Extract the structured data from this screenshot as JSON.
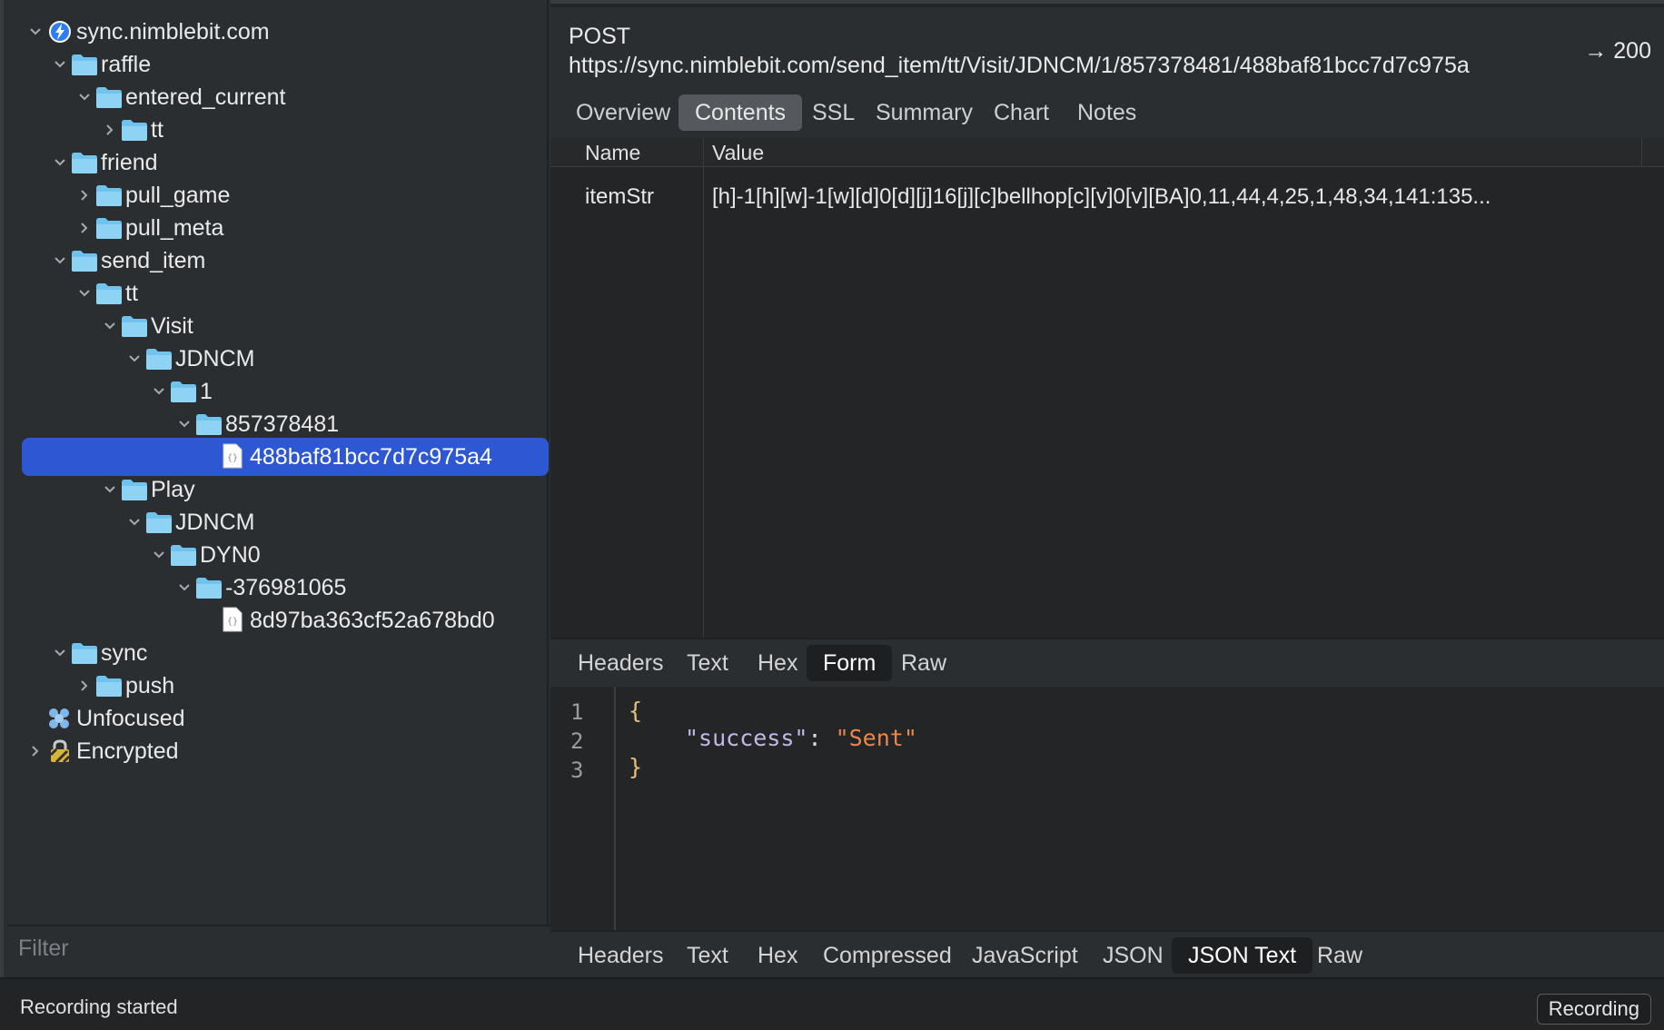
{
  "sidebar": {
    "tree": [
      {
        "label": "sync.nimblebit.com",
        "icon": "lightning-globe-icon"
      },
      {
        "label": "raffle",
        "icon": "folder-icon"
      },
      {
        "label": "entered_current",
        "icon": "folder-icon"
      },
      {
        "label": "tt",
        "icon": "folder-icon"
      },
      {
        "label": "friend",
        "icon": "folder-icon"
      },
      {
        "label": "pull_game",
        "icon": "folder-icon"
      },
      {
        "label": "pull_meta",
        "icon": "folder-icon"
      },
      {
        "label": "send_item",
        "icon": "folder-icon"
      },
      {
        "label": "tt",
        "icon": "folder-icon"
      },
      {
        "label": "Visit",
        "icon": "folder-icon"
      },
      {
        "label": "JDNCM",
        "icon": "folder-icon"
      },
      {
        "label": "1",
        "icon": "folder-icon"
      },
      {
        "label": "857378481",
        "icon": "folder-icon"
      },
      {
        "label": "488baf81bcc7d7c975a4",
        "icon": "json-file-icon",
        "selected": true
      },
      {
        "label": "Play",
        "icon": "folder-icon"
      },
      {
        "label": "JDNCM",
        "icon": "folder-icon"
      },
      {
        "label": "DYN0",
        "icon": "folder-icon"
      },
      {
        "label": "-376981065",
        "icon": "folder-icon"
      },
      {
        "label": "8d97ba363cf52a678bd0",
        "icon": "json-file-icon"
      },
      {
        "label": "sync",
        "icon": "folder-icon"
      },
      {
        "label": "push",
        "icon": "folder-icon"
      },
      {
        "label": "Unfocused",
        "icon": "unfocused-icon"
      },
      {
        "label": "Encrypted",
        "icon": "lock-icon"
      }
    ],
    "filter_placeholder": "Filter"
  },
  "request": {
    "method": "POST",
    "url": "https://sync.nimblebit.com/send_item/tt/Visit/JDNCM/1/857378481/488baf81bcc7d7c975a",
    "status": "200",
    "status_arrow": "→"
  },
  "top_tabs": [
    "Overview",
    "Contents",
    "SSL",
    "Summary",
    "Chart",
    "Notes"
  ],
  "form_table": {
    "col_name": "Name",
    "col_value": "Value",
    "rows": [
      {
        "name": "itemStr",
        "value": "[h]-1[h][w]-1[w][d]0[d][j]16[j][c]bellhop[c][v]0[v][BA]0,11,44,4,25,1,48,34,141:135..."
      }
    ]
  },
  "request_tabs": [
    "Headers",
    "Text",
    "Hex",
    "Form",
    "Raw"
  ],
  "response_code": {
    "line_numbers": [
      "1",
      "2",
      "3"
    ],
    "open_brace": "{",
    "key": "\"success\"",
    "colon": ": ",
    "value": "\"Sent\"",
    "close_brace": "}"
  },
  "response_tabs": [
    "Headers",
    "Text",
    "Hex",
    "Compressed",
    "JavaScript",
    "JSON",
    "JSON Text",
    "Raw"
  ],
  "status_bar": {
    "message": "Recording started",
    "recording_button": "Recording"
  },
  "colors": {
    "selection": "#2e57d3",
    "folder": "#6fc3ec",
    "json_key": "#c3b8e6",
    "json_string": "#e8884e"
  }
}
